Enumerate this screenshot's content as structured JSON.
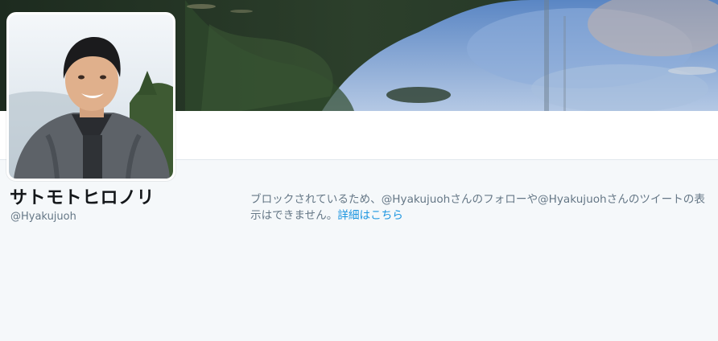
{
  "profile": {
    "display_name": "サトモトヒロノリ",
    "handle": "@Hyakujuoh"
  },
  "blocked_notice": {
    "message": "ブロックされているため、@Hyakujuohさんのフォローや@Hyakujuohさんのツイートの表示はできません。",
    "link_label": "詳細はこちら"
  },
  "colors": {
    "background": "#f5f8fa",
    "text_primary": "#14171a",
    "text_secondary": "#657786",
    "link": "#1b95e0"
  }
}
